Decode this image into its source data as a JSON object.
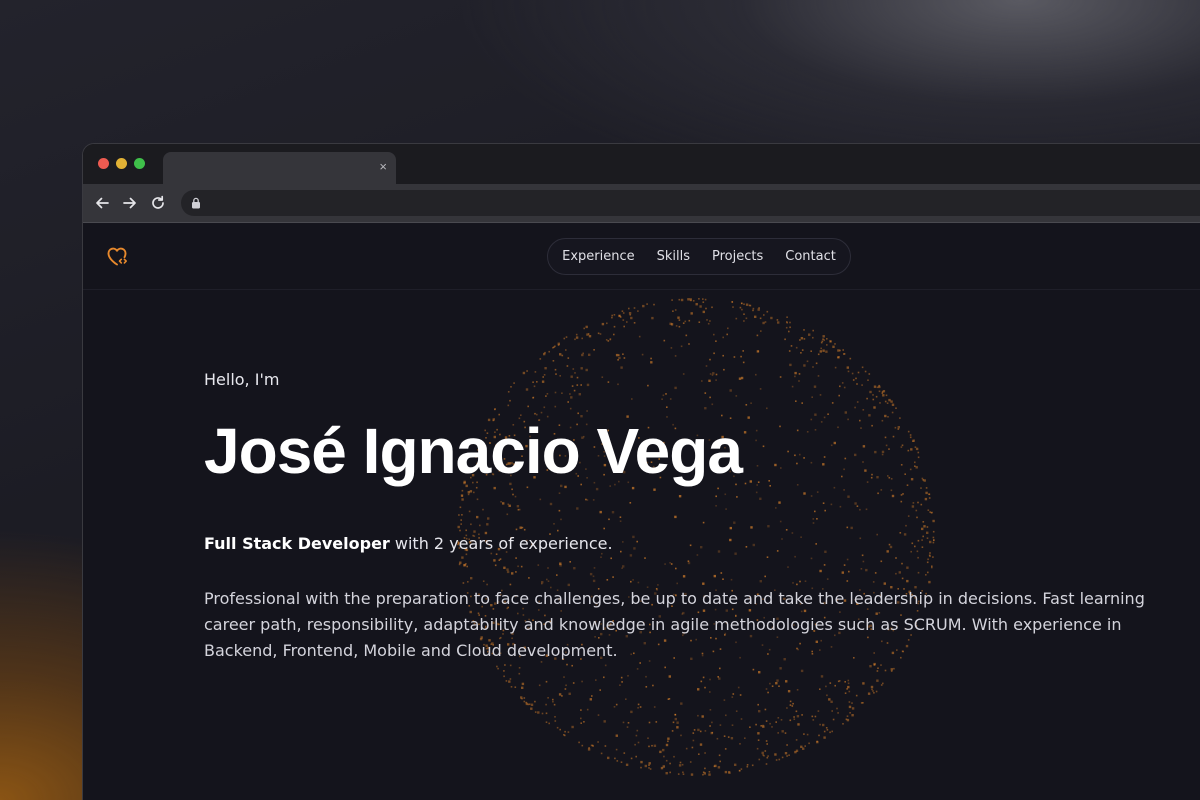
{
  "browser": {
    "tab_close": "×",
    "nav_icons": [
      "back-arrow-icon",
      "forward-arrow-icon",
      "reload-icon"
    ],
    "address_icon": "lock-icon"
  },
  "site": {
    "logo_icon": "heart-code-icon",
    "nav": [
      {
        "label": "Experience"
      },
      {
        "label": "Skills"
      },
      {
        "label": "Projects"
      },
      {
        "label": "Contact"
      }
    ],
    "hero": {
      "greeting": "Hello, I'm",
      "name": "José Ignacio Vega",
      "role": "Full Stack Developer",
      "role_suffix": " with 2 years of experience.",
      "bio": "Professional with the preparation to face challenges, be up to date and take the leadership in decisions. Fast learning career path, responsibility, adaptability and knowledge in agile methodologies such as SCRUM. With experience in Backend, Frontend, Mobile and Cloud development."
    }
  },
  "colors": {
    "accent": "#e8892c",
    "background": "#14141c",
    "text": "#ffffff"
  }
}
